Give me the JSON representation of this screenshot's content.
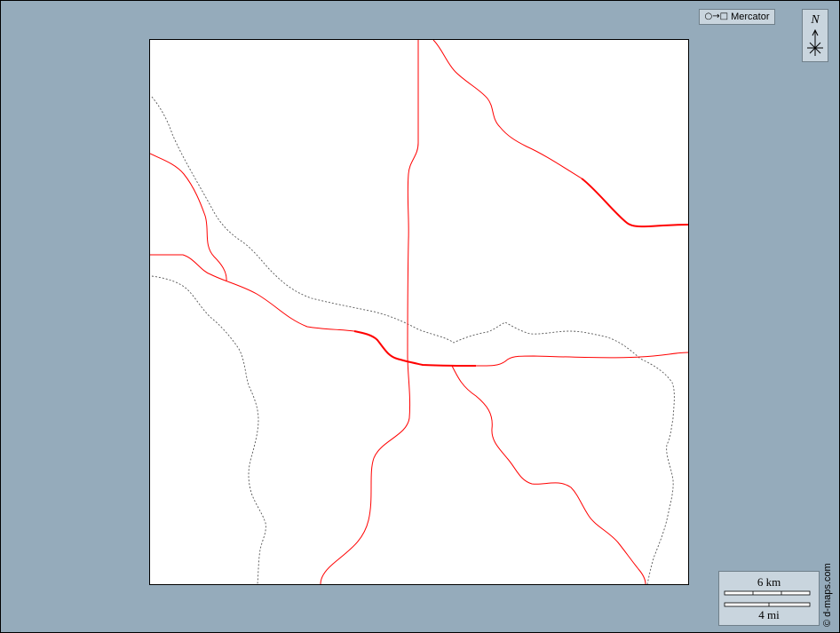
{
  "projection": {
    "symbol": "○→□",
    "label": "Mercator"
  },
  "north_arrow": {
    "letter": "N",
    "icon": "compass-rose-icon"
  },
  "scale_bar": {
    "metric_label": "6 km",
    "imperial_label": "4 mi"
  },
  "credit": "© d-maps.com",
  "colors": {
    "background": "#95abbb",
    "land": "#ffffff",
    "road": "#ff0000",
    "border": "#555555",
    "panel": "#c9d5de"
  },
  "layers": [
    "road-network",
    "administrative-border"
  ]
}
